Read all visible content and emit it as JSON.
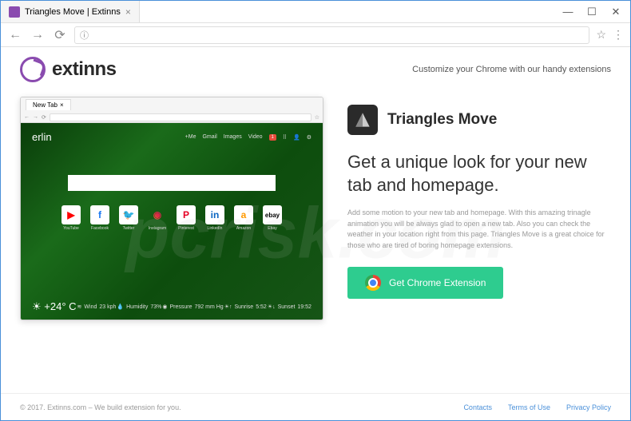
{
  "browser": {
    "tab_title": "Triangles Move | Extinns",
    "address_hint": "ⓘ"
  },
  "header": {
    "brand": "extinns",
    "tagline": "Customize your Chrome with our handy extensions"
  },
  "preview": {
    "tab_label": "New Tab",
    "city": "erlin",
    "top_links": [
      "+Me",
      "Gmail",
      "Images",
      "Video"
    ],
    "notif_count": "1",
    "icons": [
      {
        "label": "YouTube",
        "glyph": "▶",
        "cls": "ico-yt"
      },
      {
        "label": "Facebook",
        "glyph": "f",
        "cls": "ico-fb"
      },
      {
        "label": "Twitter",
        "glyph": "🐦",
        "cls": "ico-tw"
      },
      {
        "label": "Instagram",
        "glyph": "◉",
        "cls": "ico-ig"
      },
      {
        "label": "Pinterest",
        "glyph": "P",
        "cls": "ico-pn"
      },
      {
        "label": "LinkedIn",
        "glyph": "in",
        "cls": "ico-li"
      },
      {
        "label": "Amazon",
        "glyph": "a",
        "cls": "ico-am"
      },
      {
        "label": "Ebay",
        "glyph": "ebay",
        "cls": "ico-eb"
      }
    ],
    "temp": "+24° C",
    "stats": {
      "wind_label": "Wind",
      "wind_val": "23 kph",
      "humidity_label": "Humidity",
      "humidity_val": "73%",
      "pressure_label": "Pressure",
      "pressure_val": "792 mm Hg",
      "sunrise_label": "Sunrise",
      "sunrise_val": "5:52",
      "sunset_label": "Sunset",
      "sunset_val": "19:52"
    }
  },
  "promo": {
    "title": "Triangles Move",
    "headline": "Get a unique look for your new tab and homepage.",
    "description": "Add some motion to your new tab and homepage. With this amazing trinagle animation you will be always glad to open a new tab. Also you can check the weather in your location right from this page. Triangles Move is a great choice for those who are tired of boring homepage extensions.",
    "cta": "Get Chrome Extension"
  },
  "footer": {
    "copyright": "© 2017. Extinns.com – We build extension for you.",
    "links": [
      "Contacts",
      "Terms of Use",
      "Privacy Policy"
    ]
  },
  "watermark": "pcrisk.com"
}
